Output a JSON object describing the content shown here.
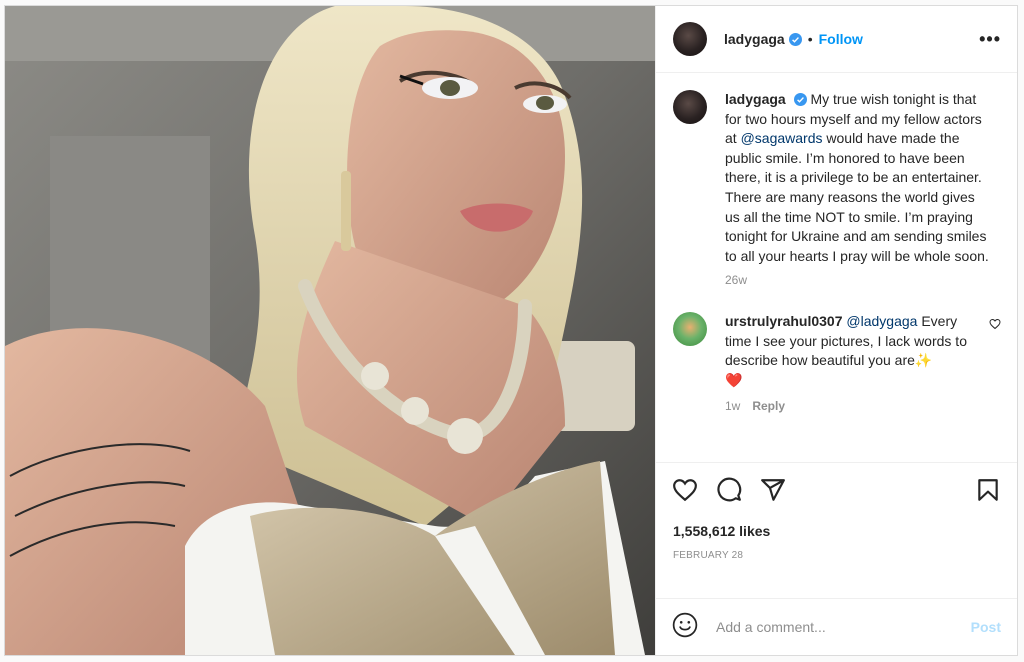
{
  "post": {
    "username": "ladygaga",
    "verified": true,
    "dot": "•",
    "follow_label": "Follow",
    "more_label": "•••"
  },
  "caption": {
    "username": "ladygaga",
    "text_before": "My true wish tonight is that for two hours myself and my fellow actors at ",
    "mention": "@sagawards",
    "text_after": " would have made the public smile. I’m honored to have been there, it is a privilege to be an entertainer. There are many reasons the world gives us all the time NOT to smile. I’m praying tonight for Ukraine and am sending smiles to all your hearts I pray will be whole soon.",
    "age": "26w"
  },
  "comments": [
    {
      "username": "urstrulyrahul0307",
      "mention": "@ladygaga",
      "text": " Every time I see your pictures, I lack words to describe how beautiful you are",
      "emoji": "✨",
      "emoji2": "❤️",
      "age": "1w",
      "reply_label": "Reply"
    }
  ],
  "actions": {
    "like_icon": "heart-outline-icon",
    "comment_icon": "comment-icon",
    "share_icon": "paper-plane-icon",
    "save_icon": "bookmark-icon",
    "likes": "1,558,612 likes",
    "date": "FEBRUARY 28"
  },
  "add_comment": {
    "placeholder": "Add a comment...",
    "post_label": "Post",
    "emoji_icon": "smiley-icon"
  },
  "colors": {
    "accent": "#0095f6",
    "post_disabled": "#b2dffc",
    "mention": "#00376b",
    "muted": "#8e8e8e",
    "heart": "#ed4956"
  }
}
